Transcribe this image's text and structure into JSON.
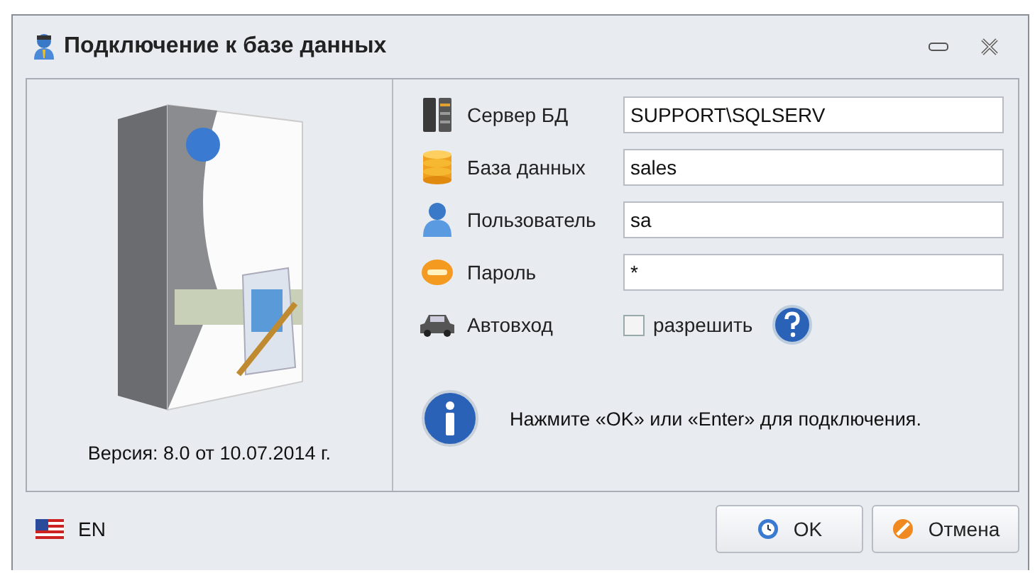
{
  "window": {
    "title": "Подключение к базе данных"
  },
  "version": "Версия: 8.0 от 10.07.2014 г.",
  "fields": [
    {
      "kind": "server",
      "label": "Сервер БД",
      "value": "SUPPORT\\SQLSERV"
    },
    {
      "kind": "database",
      "label": "База данных",
      "value": "sales"
    },
    {
      "kind": "user",
      "label": "Пользователь",
      "value": "sa"
    },
    {
      "kind": "password",
      "label": "Пароль",
      "value": "*"
    }
  ],
  "autologin": {
    "label": "Автовход",
    "checkbox_label": "разрешить",
    "checked": false
  },
  "hint": "Нажмите «OK» или «Enter» для подключения.",
  "language": "EN",
  "buttons": [
    {
      "kind": "ok",
      "label": "OK"
    },
    {
      "kind": "cancel",
      "label": "Отмена"
    }
  ]
}
